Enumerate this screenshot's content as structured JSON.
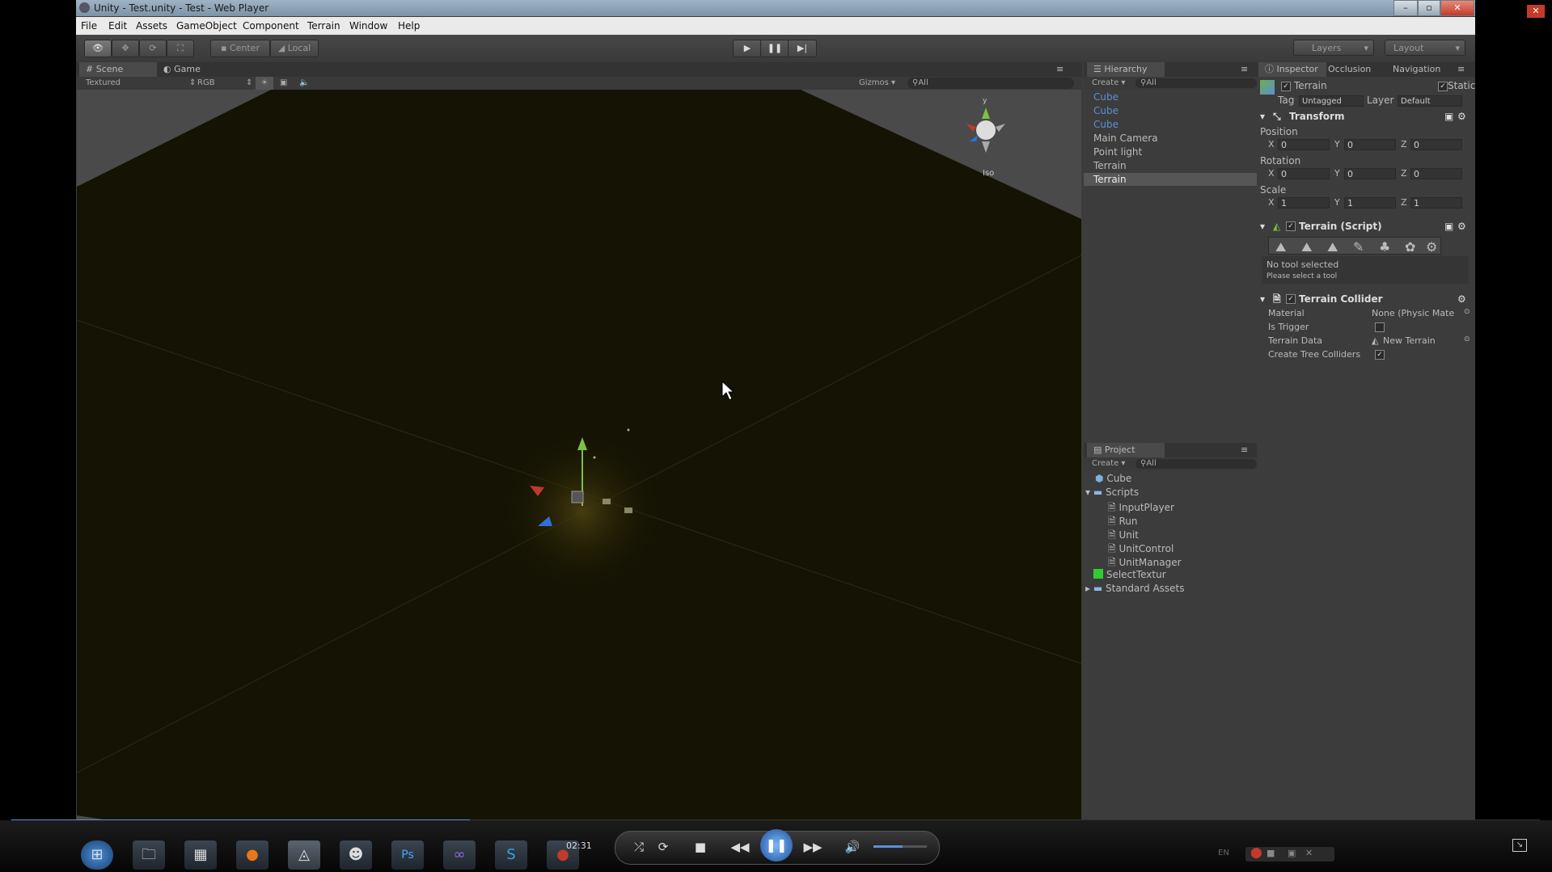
{
  "window": {
    "title": "Unity - Test.unity - Test - Web Player",
    "controls": [
      "–",
      "▫",
      "✕"
    ]
  },
  "menu": [
    "File",
    "Edit",
    "Assets",
    "GameObject",
    "Component",
    "Terrain",
    "Window",
    "Help"
  ],
  "toolbar": {
    "pivot": "Center",
    "space": "Local",
    "layers": "Layers",
    "layout": "Layout"
  },
  "scene": {
    "tab_scene": "Scene",
    "tab_game": "Game",
    "draw_mode": "Textured",
    "render_mode": "RGB",
    "gizmos": "Gizmos",
    "search": "All",
    "projection": "Iso"
  },
  "hierarchy": {
    "title": "Hierarchy",
    "create": "Create",
    "search": "All",
    "items": [
      "Cube",
      "Cube",
      "Cube",
      "Main Camera",
      "Point light",
      "Terrain",
      "Terrain"
    ]
  },
  "project": {
    "title": "Project",
    "create": "Create",
    "search": "All",
    "items": {
      "cube": "Cube",
      "scripts": "Scripts",
      "inputplayer": "InputPlayer",
      "run": "Run",
      "unit": "Unit",
      "unitcontrol": "UnitControl",
      "unitmanager": "UnitManager",
      "selecttexture": "SelectTextur",
      "standard_assets": "Standard Assets"
    }
  },
  "inspector": {
    "tabs": [
      "Inspector",
      "Occlusion",
      "Navigation"
    ],
    "object_name": "Terrain",
    "static": "Static",
    "tag_label": "Tag",
    "tag_value": "Untagged",
    "layer_label": "Layer",
    "layer_value": "Default",
    "transform": {
      "title": "Transform",
      "position_label": "Position",
      "position": [
        "0",
        "0",
        "0"
      ],
      "rotation_label": "Rotation",
      "rotation": [
        "0",
        "0",
        "0"
      ],
      "scale_label": "Scale",
      "scale": [
        "1",
        "1",
        "1"
      ],
      "axes": [
        "X",
        "Y",
        "Z"
      ]
    },
    "terrain_script": {
      "title": "Terrain (Script)",
      "no_tool": "No tool selected",
      "hint": "Please select a tool"
    },
    "terrain_collider": {
      "title": "Terrain Collider",
      "material_label": "Material",
      "material_value": "None (Physic Mate",
      "trigger_label": "Is Trigger",
      "data_label": "Terrain Data",
      "data_value": "New Terrain",
      "tree_label": "Create Tree Colliders"
    }
  },
  "player": {
    "time": "02:31",
    "progress": 0.3,
    "volume": 0.55
  },
  "tray": {
    "lang": "EN"
  },
  "colors": {
    "scene_bg": "#151303",
    "selected": "#4d6b9a",
    "progress": "#5b8fd6"
  }
}
